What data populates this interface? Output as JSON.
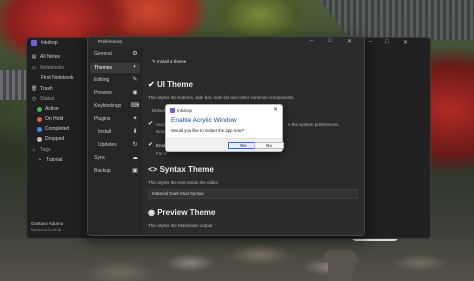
{
  "app": {
    "title": "Inkdrop",
    "window_controls": {
      "minimize": "–",
      "maximize": "□",
      "close": "✕"
    },
    "sidebar": {
      "all_notes": "All Notes",
      "notebooks": "Notebooks",
      "first_notebook": "First Notebook",
      "trash": "Trash",
      "status": "Status",
      "statuses": [
        {
          "label": "Active",
          "color": "#3fb950"
        },
        {
          "label": "On Hold",
          "color": "#e3633f"
        },
        {
          "label": "Completed",
          "color": "#4f88d8"
        },
        {
          "label": "Dropped",
          "color": "#bdbdbd"
        }
      ],
      "tags": "Tags",
      "tag_items": [
        "Tutorial"
      ],
      "user": "Gustavo Adorno",
      "synced": "Synced at 20:34:46"
    }
  },
  "settings": {
    "title": "Preferences",
    "window_controls": {
      "minimize": "–",
      "maximize": "□",
      "close": "✕"
    },
    "nav": [
      "General",
      "Themes",
      "Editing",
      "Preview",
      "Keybindings",
      "Plugins",
      "Install",
      "Updates",
      "Sync",
      "Backup"
    ],
    "active_nav": "Themes",
    "install_theme": "Install a theme",
    "ui_theme": {
      "heading": "UI Theme",
      "description": "This styles the buttons, side bar, note list and other common components",
      "default_value": "Default",
      "auto_label": "Autom",
      "auto_tail": "n the system preferences",
      "note_label": "Note: T",
      "enable_label": "Enabl",
      "enable_sub": "For V"
    },
    "syntax_theme": {
      "heading": "Syntax Theme",
      "description": "This styles the text inside the editor",
      "value": "Material Dark Mod Syntax"
    },
    "preview_theme": {
      "heading": "Preview Theme",
      "description": "This styles the Markdown output"
    }
  },
  "dialog": {
    "app_name": "Inkdrop",
    "close": "✕",
    "heading": "Enable Acrylic Window",
    "message": "Would you like to restart the app now?",
    "yes": "Yes",
    "no": "No"
  }
}
